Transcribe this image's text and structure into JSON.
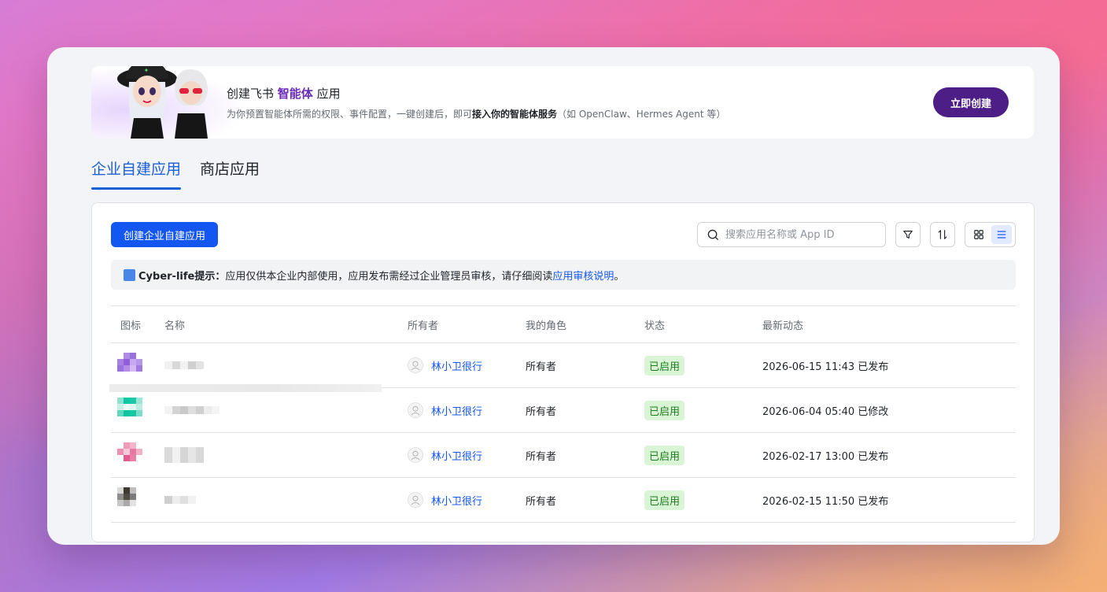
{
  "banner": {
    "title_prefix": "创建飞书 ",
    "title_highlight": "智能体",
    "title_suffix": " 应用",
    "desc_prefix": "为你预置智能体所需的权限、事件配置，一键创建后，即可",
    "desc_bold": "接入你的智能体服务",
    "desc_suffix": "（如 OpenClaw、Hermes Agent 等）",
    "create_now_label": "立即创建"
  },
  "tabs": [
    {
      "label": "企业自建应用",
      "active": true
    },
    {
      "label": "商店应用",
      "active": false
    }
  ],
  "toolbar": {
    "create_app_label": "创建企业自建应用",
    "search_placeholder": "搜索应用名称或 App ID"
  },
  "notice": {
    "title": "Cyber-life提示：",
    "text": "应用仅供本企业内部使用，应用发布需经过企业管理员审核，请仔细阅读 ",
    "link": "应用审核说明",
    "end": "。"
  },
  "table": {
    "headers": [
      "图标",
      "名称",
      "所有者",
      "我的角色",
      "状态",
      "最新动态"
    ],
    "rows": [
      {
        "owner": "林小卫很行",
        "role": "所有者",
        "status": "已启用",
        "activity": "2026-06-15 11:43 已发布"
      },
      {
        "owner": "林小卫很行",
        "role": "所有者",
        "status": "已启用",
        "activity": "2026-06-04 05:40 已修改"
      },
      {
        "owner": "林小卫很行",
        "role": "所有者",
        "status": "已启用",
        "activity": "2026-02-17 13:00 已发布"
      },
      {
        "owner": "林小卫很行",
        "role": "所有者",
        "status": "已启用",
        "activity": "2026-02-15 11:50 已发布"
      }
    ]
  },
  "colors": {
    "accent_blue": "#1456f0",
    "brand_purple": "#4d1e86",
    "status_green_bg": "#d9f5d6"
  }
}
